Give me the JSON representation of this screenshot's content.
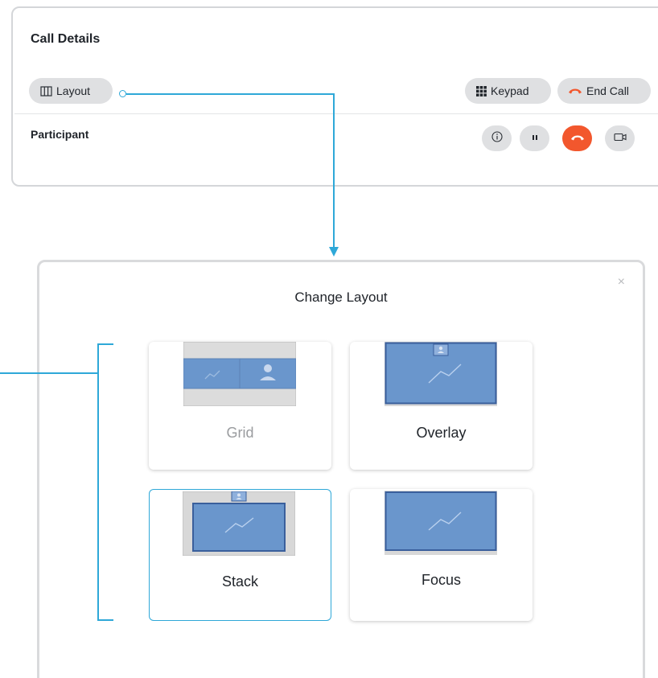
{
  "call": {
    "title": "Call Details",
    "layout_label": "Layout",
    "keypad_label": "Keypad",
    "endcall_label": "End Call",
    "participant_label": "Participant"
  },
  "dialog": {
    "title": "Change Layout",
    "close_symbol": "×",
    "options": [
      {
        "label": "Grid",
        "selected": false,
        "dimmed": true
      },
      {
        "label": "Overlay",
        "selected": false,
        "dimmed": false
      },
      {
        "label": "Stack",
        "selected": true,
        "dimmed": false
      },
      {
        "label": "Focus",
        "selected": false,
        "dimmed": false
      }
    ]
  },
  "colors": {
    "accent": "#2ea8d8",
    "end_call_red": "#f2572d",
    "thumb_blue": "#6a96cc",
    "thumb_border": "#3a5f9c",
    "thumb_grey": "#d8d8d8"
  },
  "icons": {
    "layout": "layout-columns-icon",
    "keypad": "keypad-grid-icon",
    "end_call": "hangup-handset-icon",
    "info": "info-icon",
    "hold": "pause-icon",
    "hangup": "hangup-icon",
    "video": "camera-icon"
  }
}
